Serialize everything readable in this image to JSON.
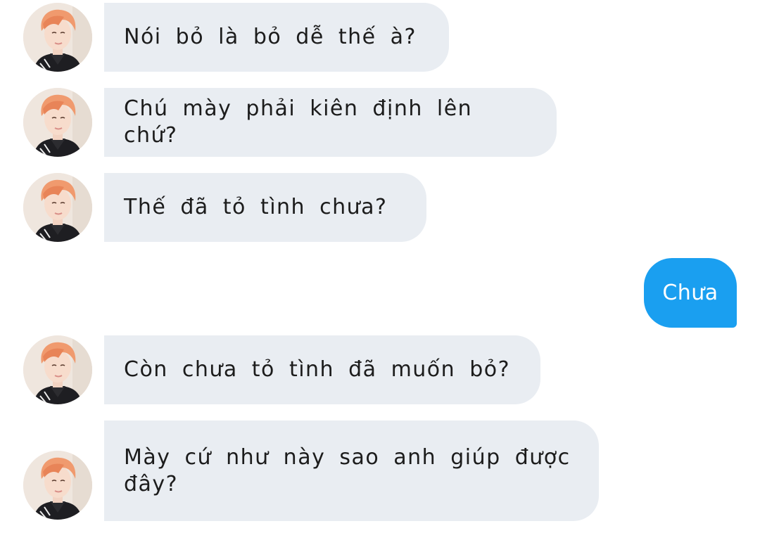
{
  "conversation": {
    "messages": [
      {
        "sender": "other",
        "text": "Nói bỏ là bỏ dễ thế à?",
        "avatar_icon": "orange-hair-avatar-icon"
      },
      {
        "sender": "other",
        "text": "Chú mày phải kiên định lên chứ?",
        "avatar_icon": "orange-hair-avatar-icon"
      },
      {
        "sender": "other",
        "text": "Thế đã tỏ tình chưa?",
        "avatar_icon": "orange-hair-avatar-icon"
      },
      {
        "sender": "me",
        "text": "Chưa"
      },
      {
        "sender": "other",
        "text": "Còn chưa tỏ tình đã muốn bỏ?",
        "avatar_icon": "orange-hair-avatar-icon"
      },
      {
        "sender": "other",
        "text": "Mày cứ như này sao anh giúp được đây?",
        "avatar_icon": "orange-hair-avatar-icon"
      }
    ]
  },
  "colors": {
    "incoming_bubble": "#e9edf2",
    "outgoing_bubble": "#1a9ff0",
    "incoming_text": "#1c1c1c",
    "outgoing_text": "#ffffff"
  }
}
